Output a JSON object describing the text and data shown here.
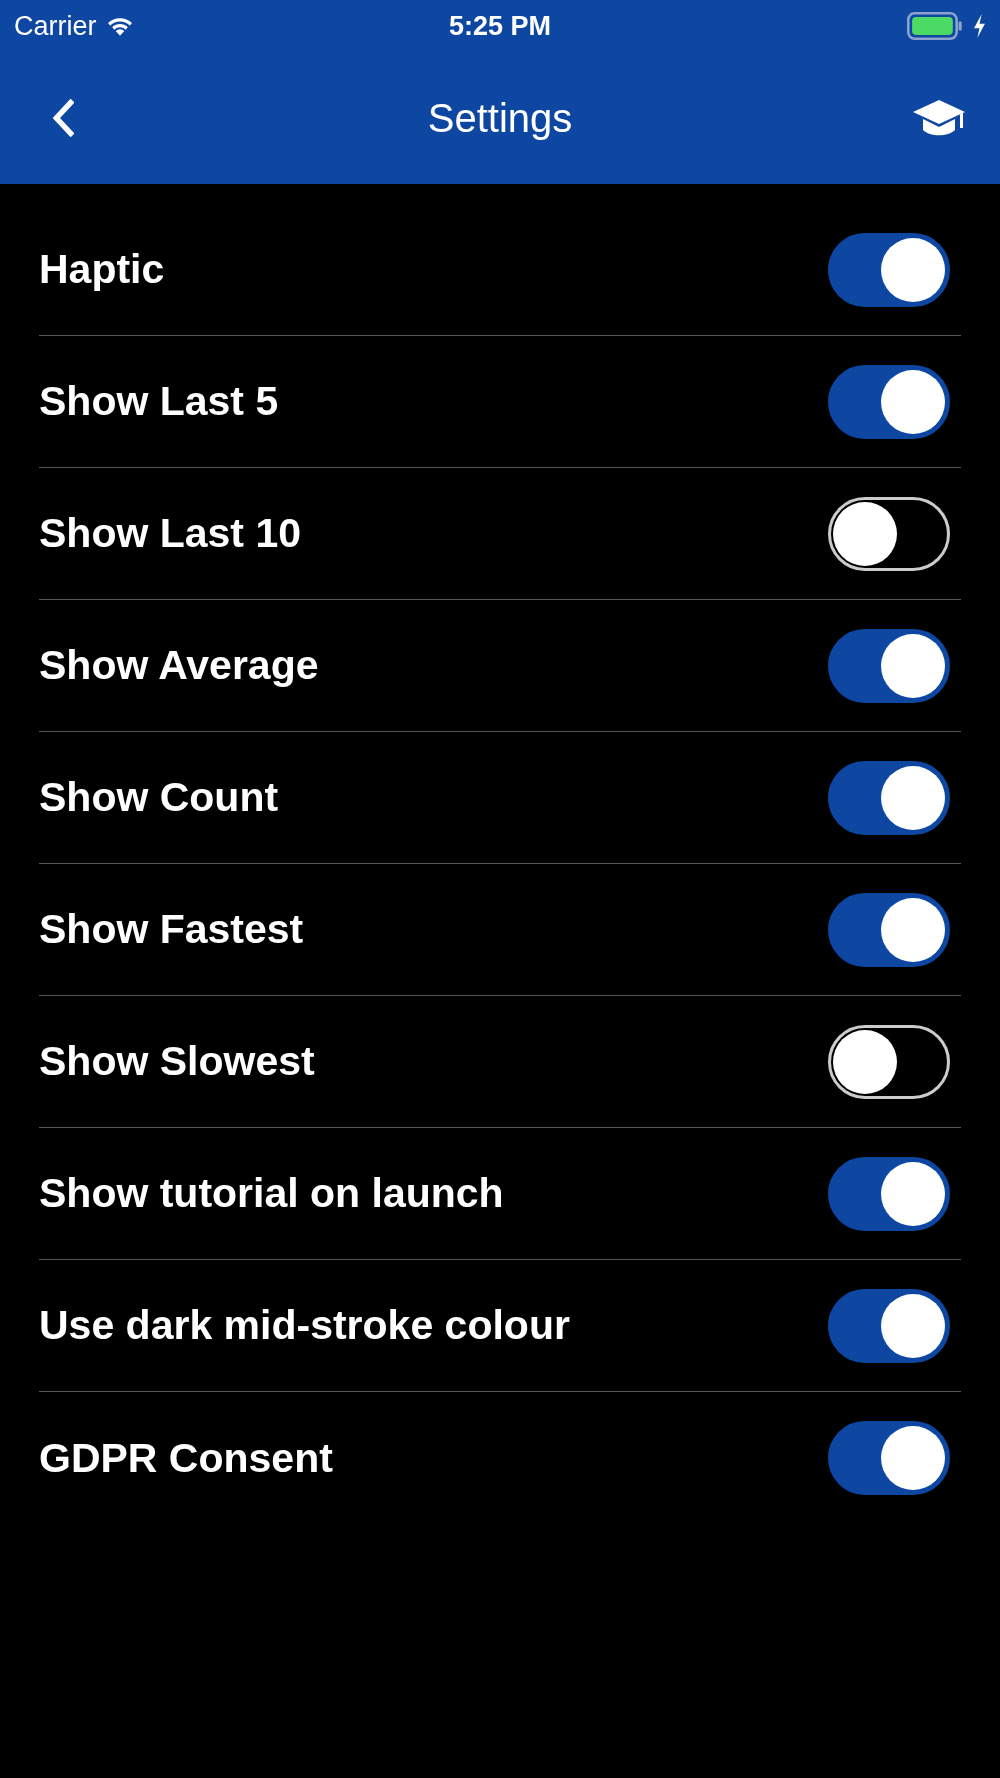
{
  "status_bar": {
    "carrier": "Carrier",
    "time": "5:25 PM"
  },
  "nav_bar": {
    "title": "Settings"
  },
  "settings": [
    {
      "label": "Haptic",
      "on": true
    },
    {
      "label": "Show Last 5",
      "on": true
    },
    {
      "label": "Show Last 10",
      "on": false
    },
    {
      "label": "Show Average",
      "on": true
    },
    {
      "label": "Show Count",
      "on": true
    },
    {
      "label": "Show Fastest",
      "on": true
    },
    {
      "label": "Show Slowest",
      "on": false
    },
    {
      "label": "Show tutorial on launch",
      "on": true
    },
    {
      "label": "Use dark mid-stroke colour",
      "on": true
    },
    {
      "label": "GDPR Consent",
      "on": true
    }
  ]
}
